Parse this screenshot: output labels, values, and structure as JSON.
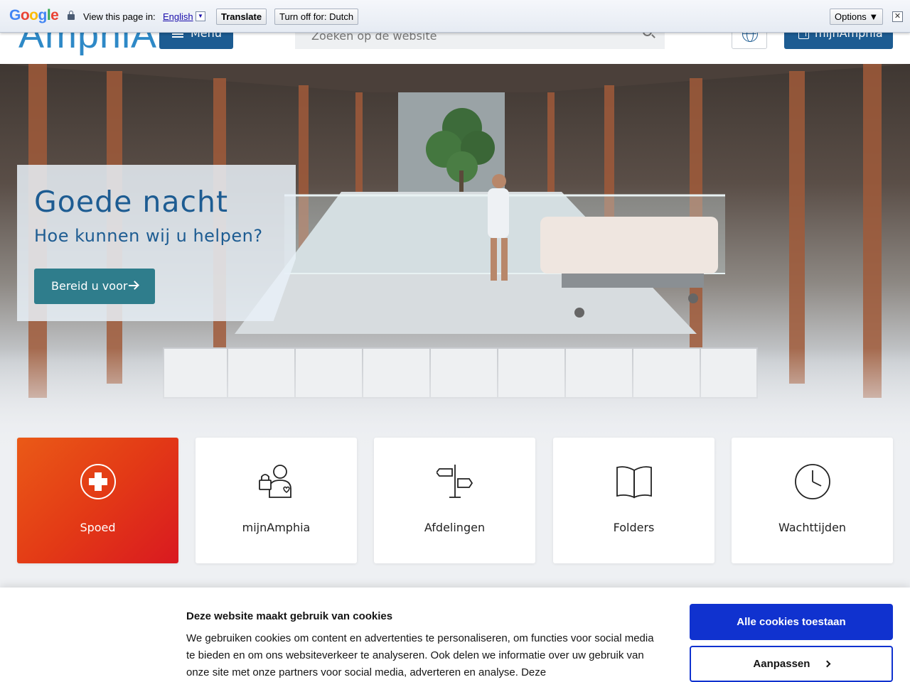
{
  "translate_bar": {
    "logo": "Google",
    "view_text": "View this page in:",
    "language": "English",
    "translate_label": "Translate",
    "turn_off_label": "Turn off for: Dutch",
    "options_label": "Options ▼",
    "close_label": "✕"
  },
  "header": {
    "logo_text": "AmphiA",
    "menu_label": "Menu",
    "search_placeholder": "Zoeken op de website",
    "mijn_label": "mijnAmphia"
  },
  "hero": {
    "title": "Goede nacht",
    "subtitle": "Hoe kunnen wij u helpen?",
    "cta_label": "Bereid u voor"
  },
  "quick_links": [
    {
      "label": "Spoed",
      "icon": "emergency-cross-icon"
    },
    {
      "label": "mijnAmphia",
      "icon": "patient-lock-icon"
    },
    {
      "label": "Afdelingen",
      "icon": "signpost-icon"
    },
    {
      "label": "Folders",
      "icon": "book-icon"
    },
    {
      "label": "Wachttijden",
      "icon": "clock-icon"
    }
  ],
  "cookie_banner": {
    "title": "Deze website maakt gebruik van cookies",
    "text": "We gebruiken cookies om content en advertenties te personaliseren, om functies voor social media te bieden en om ons websiteverkeer te analyseren. Ook delen we informatie over uw gebruik van onze site met onze partners voor social media, adverteren en analyse. Deze",
    "accept_label": "Alle cookies toestaan",
    "customize_label": "Aanpassen"
  },
  "colors": {
    "brand_blue": "#1d5c92",
    "teal": "#2f7d8c",
    "emergency_orange": "#e33a16",
    "cookie_blue": "#1032cf"
  }
}
